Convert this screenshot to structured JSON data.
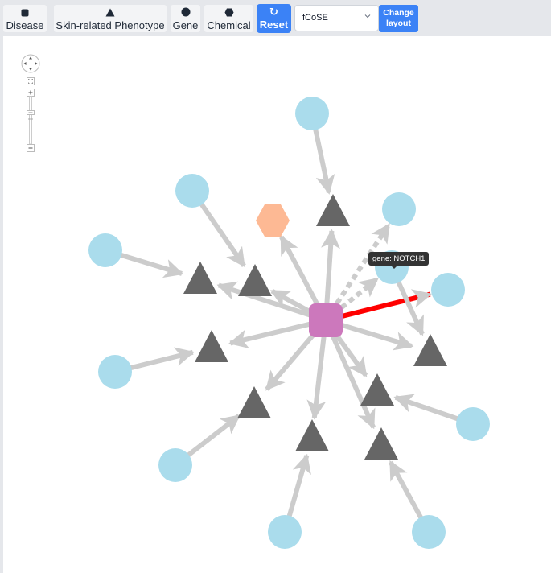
{
  "toolbar": {
    "legend": [
      {
        "label": "Disease",
        "icon": "square-icon"
      },
      {
        "label": "Skin-related Phenotype",
        "icon": "triangle-icon"
      },
      {
        "label": "Gene",
        "icon": "circle-icon"
      },
      {
        "label": "Chemical",
        "icon": "hexagon-icon"
      }
    ],
    "reset_label": "Reset",
    "reset_icon": "↻",
    "layout_select_value": "fCoSE",
    "change_layout_line1": "Change",
    "change_layout_line2": "layout"
  },
  "colors": {
    "disease": "#cc78bc",
    "phenotype": "#666666",
    "gene": "#aadcec",
    "chemical": "#fdb994",
    "edge": "#cccccc",
    "highlight_edge": "#ff0000",
    "accent": "#3b82f6"
  },
  "graph": {
    "tooltip": "gene: NOTCH1",
    "nodes": [
      {
        "id": "disease_center",
        "type": "disease"
      },
      {
        "id": "chem1",
        "type": "chemical"
      },
      {
        "id": "p_top",
        "type": "phenotype"
      },
      {
        "id": "p_left1",
        "type": "phenotype"
      },
      {
        "id": "p_left2",
        "type": "phenotype"
      },
      {
        "id": "p_midleft",
        "type": "phenotype"
      },
      {
        "id": "p_lowleft",
        "type": "phenotype"
      },
      {
        "id": "p_bottom",
        "type": "phenotype"
      },
      {
        "id": "p_right",
        "type": "phenotype"
      },
      {
        "id": "p_lowright1",
        "type": "phenotype"
      },
      {
        "id": "p_lowright2",
        "type": "phenotype"
      },
      {
        "id": "g_top",
        "type": "gene"
      },
      {
        "id": "g_upleft",
        "type": "gene"
      },
      {
        "id": "g_left",
        "type": "gene"
      },
      {
        "id": "g_midleft",
        "type": "gene"
      },
      {
        "id": "g_lowleft",
        "type": "gene"
      },
      {
        "id": "g_bottom1",
        "type": "gene"
      },
      {
        "id": "g_bottom2",
        "type": "gene"
      },
      {
        "id": "g_right",
        "type": "gene"
      },
      {
        "id": "g_upright",
        "type": "gene"
      },
      {
        "id": "g_notch1",
        "type": "gene",
        "label": "NOTCH1"
      },
      {
        "id": "g_red",
        "type": "gene"
      }
    ],
    "edges": [
      {
        "source": "disease_center",
        "target": "chem1",
        "style": "solid"
      },
      {
        "source": "disease_center",
        "target": "p_top",
        "style": "solid"
      },
      {
        "source": "disease_center",
        "target": "p_left1",
        "style": "solid"
      },
      {
        "source": "disease_center",
        "target": "p_left2",
        "style": "solid"
      },
      {
        "source": "disease_center",
        "target": "p_midleft",
        "style": "solid"
      },
      {
        "source": "disease_center",
        "target": "p_lowleft",
        "style": "solid"
      },
      {
        "source": "disease_center",
        "target": "p_bottom",
        "style": "solid"
      },
      {
        "source": "disease_center",
        "target": "p_right",
        "style": "solid"
      },
      {
        "source": "disease_center",
        "target": "p_lowright1",
        "style": "solid"
      },
      {
        "source": "disease_center",
        "target": "p_lowright2",
        "style": "solid"
      },
      {
        "source": "disease_center",
        "target": "g_upright",
        "style": "dashed"
      },
      {
        "source": "disease_center",
        "target": "g_notch1",
        "style": "dashed"
      },
      {
        "source": "disease_center",
        "target": "g_red",
        "style": "highlight"
      },
      {
        "source": "g_top",
        "target": "p_top",
        "style": "solid"
      },
      {
        "source": "g_upleft",
        "target": "p_left2",
        "style": "solid"
      },
      {
        "source": "g_left",
        "target": "p_left1",
        "style": "solid"
      },
      {
        "source": "g_midleft",
        "target": "p_midleft",
        "style": "solid"
      },
      {
        "source": "g_lowleft",
        "target": "p_lowleft",
        "style": "solid"
      },
      {
        "source": "g_bottom1",
        "target": "p_bottom",
        "style": "solid"
      },
      {
        "source": "g_bottom2",
        "target": "p_lowright2",
        "style": "solid"
      },
      {
        "source": "g_right",
        "target": "p_lowright1",
        "style": "solid"
      },
      {
        "source": "g_notch1",
        "target": "p_right",
        "style": "solid"
      }
    ]
  }
}
